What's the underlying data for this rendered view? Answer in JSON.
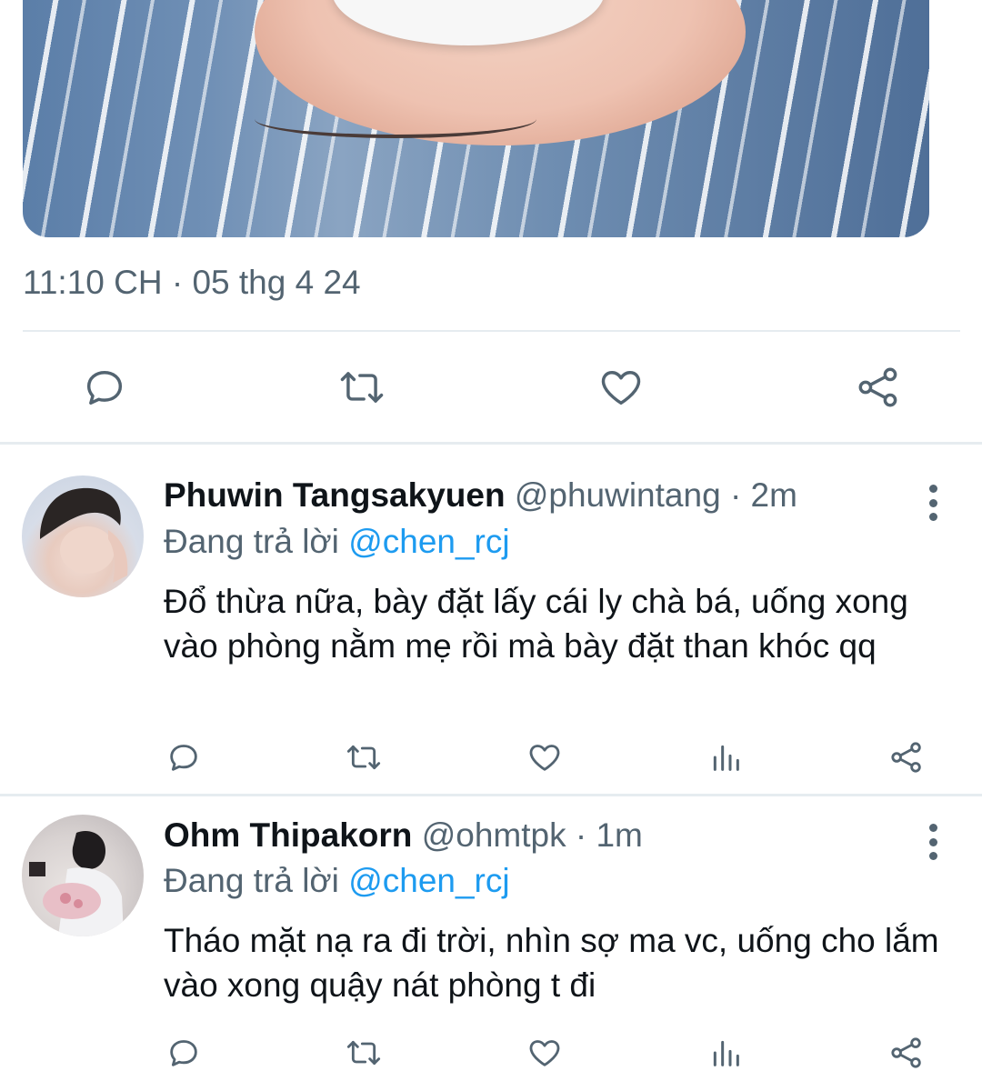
{
  "tweet": {
    "timestamp": "11:10 CH · 05 thg 4 24",
    "actions": {
      "reply_icon": "comment-bubble-icon",
      "retweet_icon": "retweet-icon",
      "like_icon": "heart-icon",
      "share_icon": "share-nodes-icon"
    }
  },
  "replies": [
    {
      "name": "Phuwin Tangsakyuen",
      "handle": "@phuwintang",
      "time": "· 2m",
      "replying_prefix": "Đang trả lời",
      "replying_to": "@chen_rcj",
      "text": "Đổ thừa nữa, bày đặt lấy cái ly chà bá, uống xong vào phòng nằm mẹ rồi mà bày đặt than khóc qq"
    },
    {
      "name": "Ohm Thipakorn",
      "handle": "@ohmtpk",
      "time": "· 1m",
      "replying_prefix": "Đang trả lời",
      "replying_to": "@chen_rcj",
      "text": "Tháo mặt nạ ra đi trời, nhìn sợ ma vc, uống cho lắm vào xong quậy nát phòng t đi"
    }
  ],
  "colors": {
    "accent": "#1d9bf0",
    "secondary_text": "#536471",
    "primary_text": "#0f1419",
    "divider": "#e6ecf0"
  }
}
